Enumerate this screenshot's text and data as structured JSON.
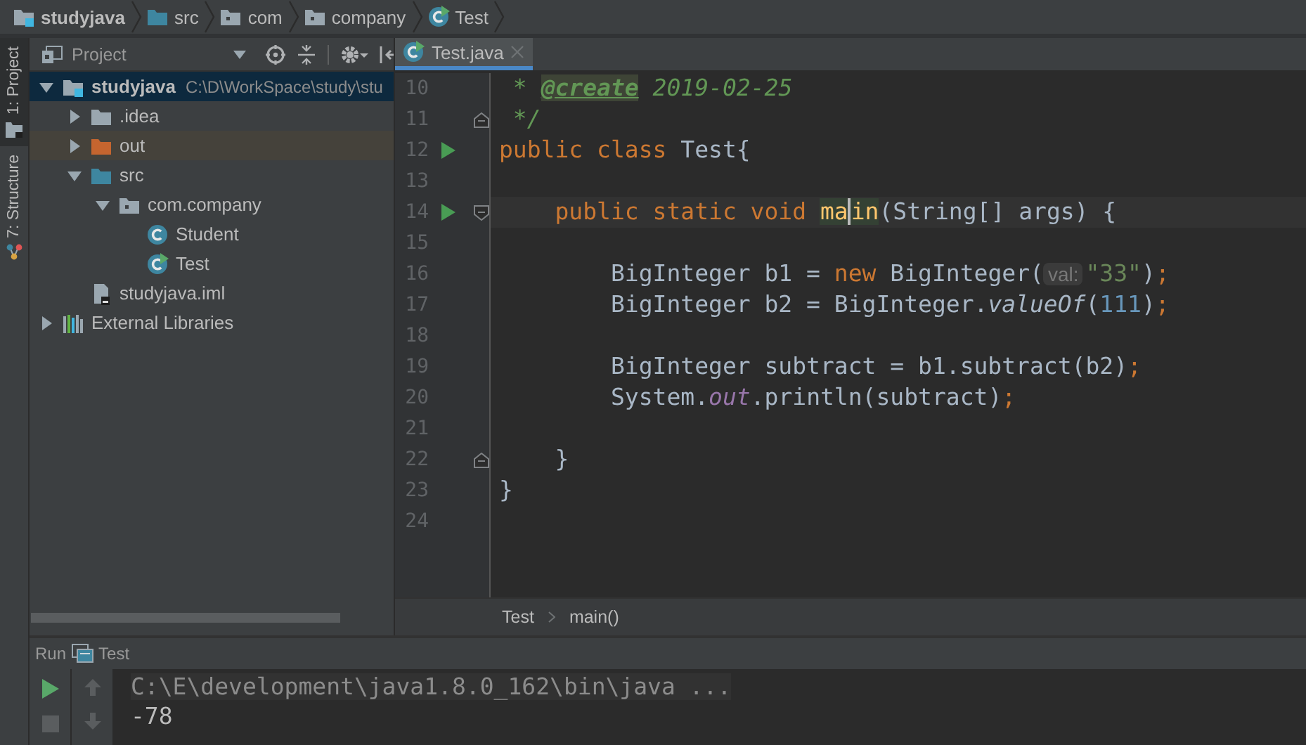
{
  "navigation_bar": [
    {
      "label": "studyjava",
      "kind": "module"
    },
    {
      "label": "src",
      "kind": "source-folder"
    },
    {
      "label": "com",
      "kind": "package"
    },
    {
      "label": "company",
      "kind": "package"
    },
    {
      "label": "Test",
      "kind": "class-main"
    }
  ],
  "tool_strip": [
    {
      "label": "1: Project",
      "kind": "project",
      "selected": true
    },
    {
      "label": "7: Structure",
      "kind": "structure",
      "selected": false
    }
  ],
  "project_panel": {
    "title": "Project",
    "tree": [
      {
        "label": "studyjava",
        "path": "C:\\D\\WorkSpace\\study\\stu",
        "kind": "module",
        "expanded": true,
        "selected": true,
        "children": [
          {
            "label": ".idea",
            "kind": "folder",
            "expanded": false,
            "selected": false
          },
          {
            "label": "out",
            "kind": "excluded-folder",
            "expanded": false,
            "selected": false
          },
          {
            "label": "src",
            "kind": "source-folder",
            "expanded": true,
            "selected": false,
            "children": [
              {
                "label": "com.company",
                "kind": "package",
                "expanded": true,
                "selected": false,
                "children": [
                  {
                    "label": "Student",
                    "kind": "class",
                    "selected": false
                  },
                  {
                    "label": "Test",
                    "kind": "class-main",
                    "selected": false
                  }
                ]
              }
            ]
          },
          {
            "label": "studyjava.iml",
            "kind": "iml-file",
            "selected": false
          }
        ]
      },
      {
        "label": "External Libraries",
        "kind": "libraries",
        "expanded": false,
        "selected": false
      }
    ]
  },
  "editor": {
    "tabs": [
      {
        "label": "Test.java",
        "kind": "class-main",
        "selected": true
      }
    ],
    "lines": [
      {
        "number": "10",
        "tokens": [
          {
            "text": " * ",
            "kind": "doc"
          },
          {
            "text": "@create",
            "kind": "doc-tag"
          },
          {
            "text": " 2019-02-25",
            "kind": "doc"
          }
        ]
      },
      {
        "number": "11",
        "fold_end": true,
        "tokens": [
          {
            "text": " */",
            "kind": "doc"
          }
        ]
      },
      {
        "number": "12",
        "run": true,
        "tokens": [
          {
            "text": "public class ",
            "kind": "keyword"
          },
          {
            "text": "Test{",
            "kind": "plain"
          }
        ]
      },
      {
        "number": "13"
      },
      {
        "number": "14",
        "run": true,
        "fold_start": true,
        "current": true,
        "tokens": [
          {
            "text": "    public static void ",
            "kind": "keyword"
          },
          {
            "text": "ma",
            "kind": "usage"
          },
          {
            "text": "in",
            "kind": "usage",
            "caret": true
          },
          {
            "text": "(String[] args) {",
            "kind": "plain"
          }
        ]
      },
      {
        "number": "15"
      },
      {
        "number": "16",
        "tokens": [
          {
            "text": "        BigInteger b1 = ",
            "kind": "plain"
          },
          {
            "text": "new",
            "kind": "keyword"
          },
          {
            "text": " BigInteger(",
            "kind": "plain"
          },
          {
            "text": "val:",
            "kind": "hint"
          },
          {
            "text": "\"33\"",
            "kind": "string"
          },
          {
            "text": ")",
            "kind": "plain"
          },
          {
            "text": ";",
            "kind": "keyword"
          }
        ]
      },
      {
        "number": "17",
        "tokens": [
          {
            "text": "        BigInteger b2 = BigInteger.",
            "kind": "plain"
          },
          {
            "text": "valueOf",
            "kind": "static-method"
          },
          {
            "text": "(",
            "kind": "plain"
          },
          {
            "text": "111",
            "kind": "number"
          },
          {
            "text": ")",
            "kind": "plain"
          },
          {
            "text": ";",
            "kind": "keyword"
          }
        ]
      },
      {
        "number": "18"
      },
      {
        "number": "19",
        "tokens": [
          {
            "text": "        BigInteger subtract = b1.subtract(b2)",
            "kind": "plain"
          },
          {
            "text": ";",
            "kind": "keyword"
          }
        ]
      },
      {
        "number": "20",
        "tokens": [
          {
            "text": "        System.",
            "kind": "plain"
          },
          {
            "text": "out",
            "kind": "static-field"
          },
          {
            "text": ".println(subtract)",
            "kind": "plain"
          },
          {
            "text": ";",
            "kind": "keyword"
          }
        ]
      },
      {
        "number": "21"
      },
      {
        "number": "22",
        "fold_end": true,
        "tokens": [
          {
            "text": "    }",
            "kind": "plain"
          }
        ]
      },
      {
        "number": "23",
        "tokens": [
          {
            "text": "}",
            "kind": "plain"
          }
        ]
      },
      {
        "number": "24"
      }
    ],
    "breadcrumbs": [
      "Test",
      "main()"
    ]
  },
  "run_panel": {
    "title": "Run",
    "configuration": "Test",
    "output": [
      {
        "text": "C:\\E\\development\\java1.8.0_162\\bin\\java ...",
        "kind": "command"
      },
      {
        "text": "-78",
        "kind": "stdout"
      }
    ]
  }
}
